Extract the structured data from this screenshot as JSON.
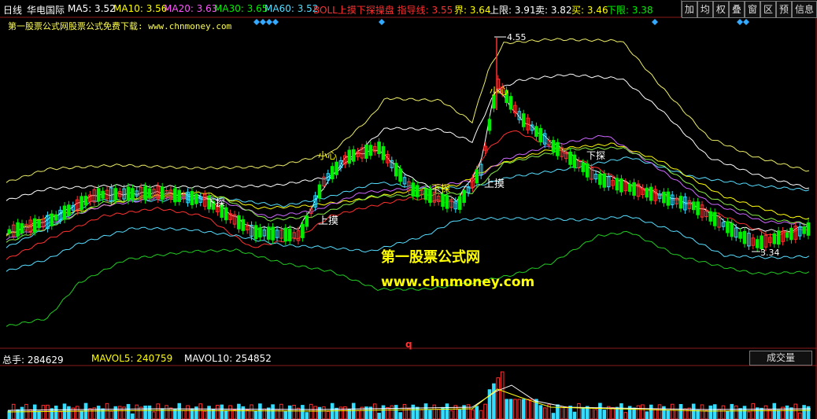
{
  "header": {
    "period": "日线",
    "stock_name": "华电国际",
    "indicators": [
      {
        "label": "MA5: 3.52",
        "color": "#ffffff"
      },
      {
        "label": "MA10: 3.56",
        "color": "#ffff00"
      },
      {
        "label": "MA20: 3.63",
        "color": "#ff55ff"
      },
      {
        "label": "MA30: 3.65",
        "color": "#00ee00"
      },
      {
        "label": "MA60: 3.52",
        "color": "#55ddff"
      },
      {
        "label": "BOLL上摸下探操盘 指导线: 3.55",
        "color": "#ff3030"
      },
      {
        "label": "界: 3.64",
        "color": "#ffff00"
      },
      {
        "label": "上限: 3.91",
        "color": "#ffffff"
      },
      {
        "label": "卖: 3.82",
        "color": "#ffffff"
      },
      {
        "label": "买: 3.46",
        "color": "#ffff00"
      },
      {
        "label": "下限: 3.38",
        "color": "#00ee00"
      }
    ]
  },
  "toolbar": [
    "加",
    "均",
    "权",
    "叠",
    "窗",
    "区",
    "预",
    "信息"
  ],
  "subtitle": "第一股票公式网股票公式免费下载: www.chnmoney.com",
  "watermark": {
    "line1": "第一股票公式网",
    "line2": "www.chnmoney.com"
  },
  "annotations": {
    "high": "4.55",
    "low": "3.34",
    "labels": [
      "上摸",
      "上摸",
      "下探",
      "下探",
      "小心",
      "小心",
      "下探"
    ],
    "marker": "q"
  },
  "volume": {
    "total": "总手: 284629",
    "mavol5": "MAVOL5: 240759",
    "mavol10": "MAVOL10: 254852",
    "tab": "成交量"
  },
  "colors": {
    "up": "#ff3030",
    "down": "#00ee00",
    "hollow_up": "#33ddff",
    "gold": "#ffff00"
  }
}
